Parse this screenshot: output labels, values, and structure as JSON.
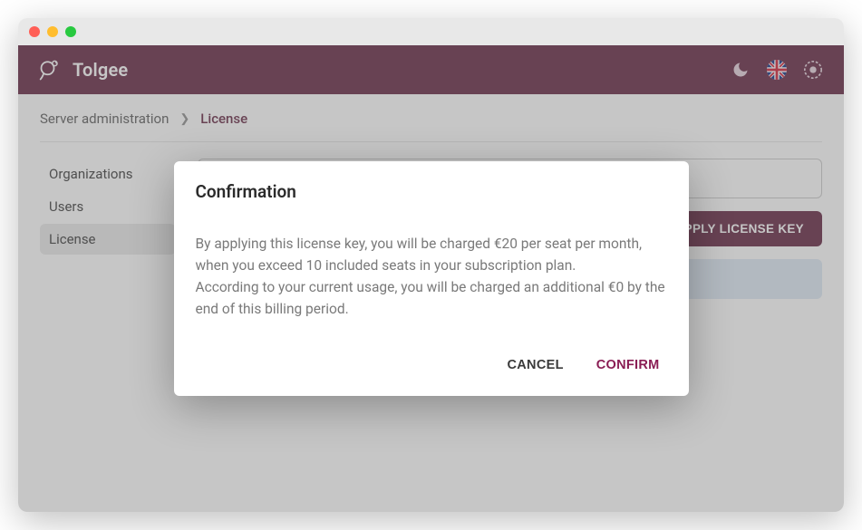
{
  "app": {
    "brand_name": "Tolgee"
  },
  "breadcrumb": {
    "root": "Server administration",
    "current": "License"
  },
  "sidebar": {
    "items": [
      {
        "label": "Organizations",
        "active": false
      },
      {
        "label": "Users",
        "active": false
      },
      {
        "label": "License",
        "active": true
      }
    ]
  },
  "main": {
    "input_value": "",
    "apply_button": "APPLY LICENSE KEY"
  },
  "modal": {
    "title": "Confirmation",
    "body_line1": "By applying this license key, you will be charged €20 per seat per month, when you exceed 10 included seats in your subscription plan.",
    "body_line2": "According to your current usage, you will be charged an additional €0 by the end of this billing period.",
    "cancel": "CANCEL",
    "confirm": "CONFIRM"
  },
  "colors": {
    "brand": "#5d1c3a",
    "confirm_text": "#8a1d54"
  }
}
